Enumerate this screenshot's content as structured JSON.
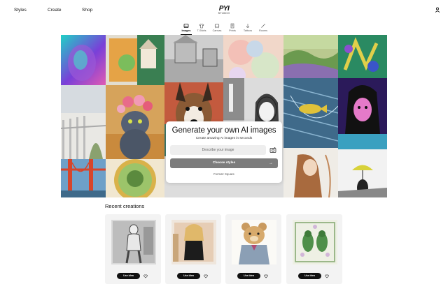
{
  "nav": {
    "styles": "Styles",
    "create": "Create",
    "shop": "Shop"
  },
  "logo": {
    "main": "PYI",
    "sub": "STUDIO"
  },
  "tabs": [
    {
      "label": "Images",
      "icon": "image-icon",
      "active": true
    },
    {
      "label": "T-Shirts",
      "icon": "tshirt-icon"
    },
    {
      "label": "Canvas",
      "icon": "canvas-icon"
    },
    {
      "label": "Prints",
      "icon": "print-icon"
    },
    {
      "label": "Tattoos",
      "icon": "tattoo-icon"
    },
    {
      "label": "Rooms",
      "icon": "wand-icon"
    }
  ],
  "hero": {
    "title": "Generate your own AI images",
    "subtitle": "Create amazing AI images in seconds",
    "prompt_placeholder": "Describe your image",
    "choose_label": "Choose styles",
    "format_label": "Format: Square"
  },
  "recent": {
    "title": "Recent creations",
    "items": [
      {
        "use_label": "Use idea"
      },
      {
        "use_label": "Use idea"
      },
      {
        "use_label": "Use idea"
      },
      {
        "use_label": "Use idea"
      }
    ]
  }
}
